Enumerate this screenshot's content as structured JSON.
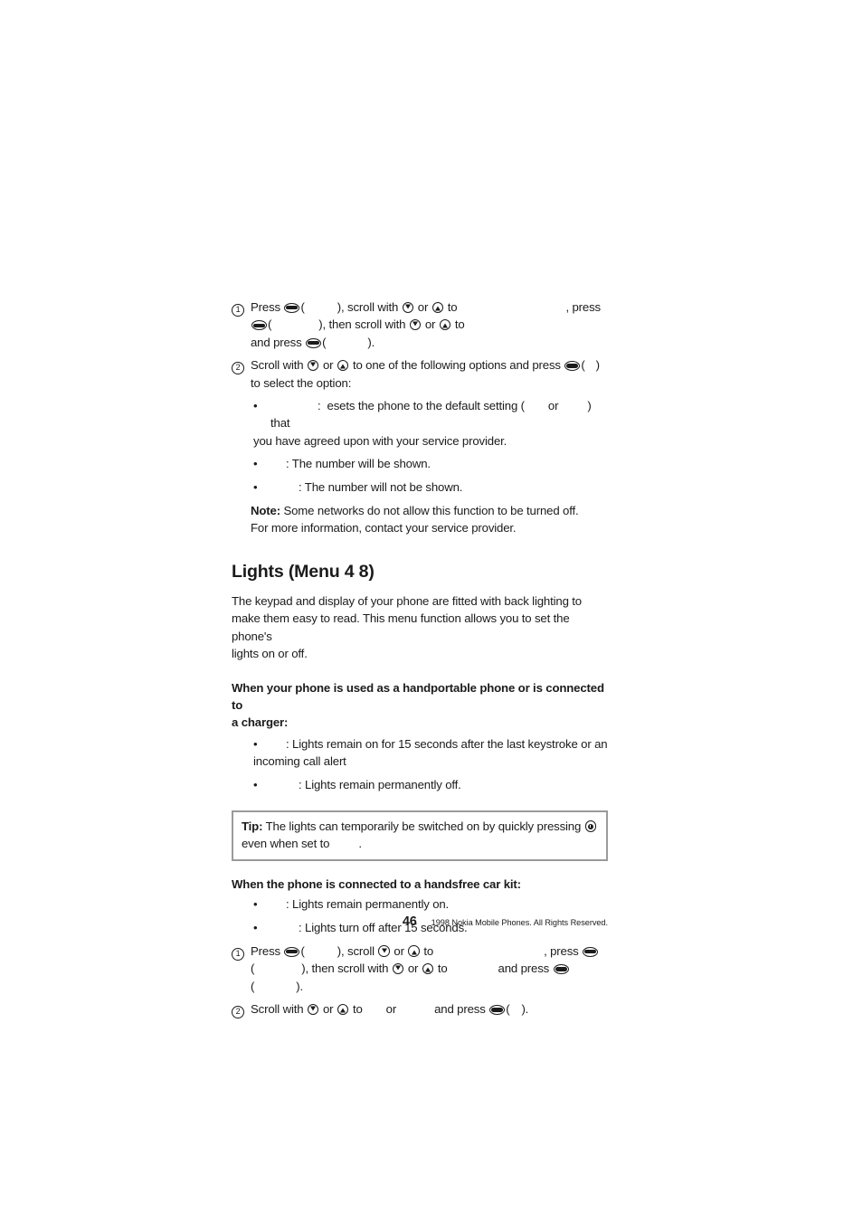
{
  "document": {
    "page_number": "46",
    "copyright": "1998 Nokia Mobile Phones. All Rights Reserved."
  },
  "top_procedure": {
    "step1": {
      "marker": "1",
      "t1": "Press",
      "t2": "(",
      "t3": "), scroll with",
      "t4": "or",
      "t5": "to",
      "t6": ", press",
      "t7": "(",
      "t8": "), then scroll with",
      "t9": "or",
      "t10": "to",
      "t11": "and press",
      "t12": "(",
      "t13": ")."
    },
    "step2": {
      "marker": "2",
      "t1": "Scroll with",
      "t2": "or",
      "t3": "to one of the following options and press",
      "t4": "(",
      "t5": ")",
      "t6": "to select the option:"
    }
  },
  "options": {
    "bullet1": {
      "dot": "•",
      "t1": ":",
      "t2": "esets the phone to the default setting (",
      "t3": "or",
      "t4": ") that",
      "t5": "you have agreed upon with your service provider."
    },
    "bullet2": {
      "dot": "•",
      "t1": ": The number will be shown."
    },
    "bullet3": {
      "dot": "•",
      "t1": ": The number will not be shown."
    },
    "note": {
      "label": "Note:",
      "line1": "Some networks do not allow this function to be turned off.",
      "line2": "For more information, contact your service provider."
    }
  },
  "lights_section": {
    "heading": "Lights (Menu 4 8)",
    "intro_line1": "The keypad and display of your phone are fitted with back lighting to",
    "intro_line2": "make them easy to read. This menu function allows you to set the phone's",
    "intro_line3": "lights on or off.",
    "handportable": {
      "heading_line1": "When your phone is used as a handportable phone or is connected to",
      "heading_line2": "a charger:",
      "bullet1": {
        "dot": "•",
        "t1": ": Lights remain on for 15 seconds after the last keystroke or an",
        "t2": "incoming call alert"
      },
      "bullet2": {
        "dot": "•",
        "t1": ": Lights remain permanently off."
      }
    },
    "tip": {
      "label": "Tip:",
      "t1": "The lights can temporarily be switched on by quickly pressing",
      "t2": "even when set to",
      "t3": "."
    },
    "carkit": {
      "heading": "When the phone is connected to a handsfree car kit:",
      "bullet1": {
        "dot": "•",
        "t1": ": Lights remain permanently on."
      },
      "bullet2": {
        "dot": "•",
        "t1": ": Lights turn off after 15 seconds."
      }
    },
    "procedure": {
      "step1": {
        "marker": "1",
        "t1": "Press",
        "t2": "(",
        "t3": "), scroll",
        "t4": "or",
        "t5": "to",
        "t6": ", press",
        "t7": "(",
        "t8": "), then scroll with",
        "t9": "or",
        "t10": "to",
        "t11": "and press",
        "t12": "(",
        "t13": ")."
      },
      "step2": {
        "marker": "2",
        "t1": "Scroll with",
        "t2": "or",
        "t3": "to",
        "t4": "or",
        "t5": "and press",
        "t6": "(",
        "t7": ")."
      }
    }
  },
  "colors": {
    "text": "#1b1b1b",
    "tip_border": "#9a9a9a",
    "page_background": "#ffffff"
  }
}
